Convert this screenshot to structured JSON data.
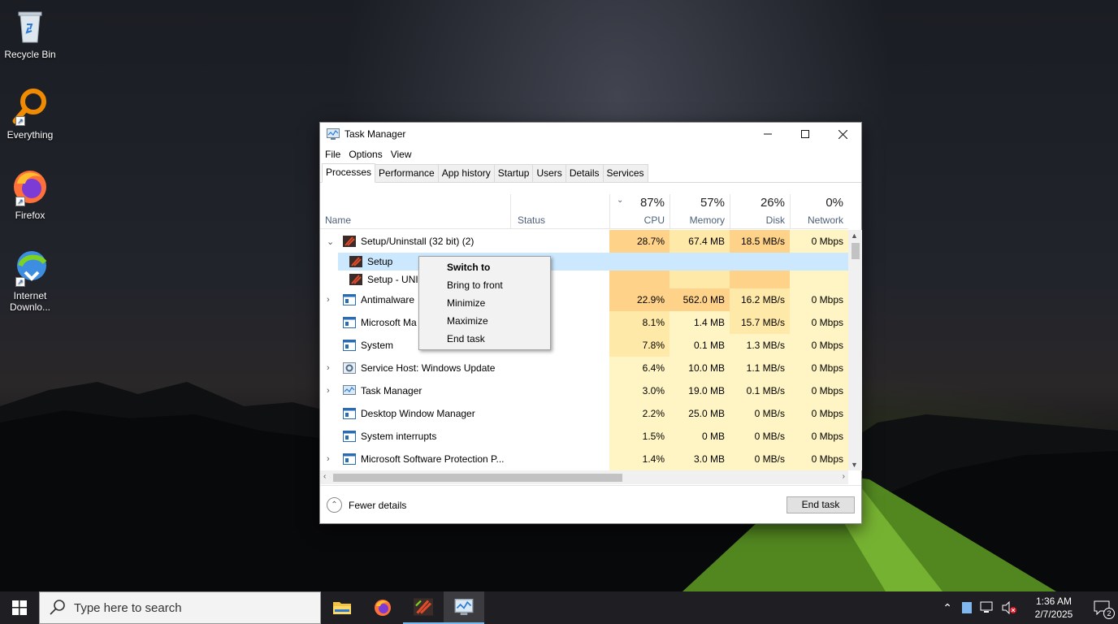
{
  "desktop": {
    "icons": [
      {
        "label": "Recycle Bin"
      },
      {
        "label": "Everything"
      },
      {
        "label": "Firefox"
      },
      {
        "label": "Internet Downlo..."
      }
    ]
  },
  "task_manager": {
    "title": "Task Manager",
    "menu": [
      "File",
      "Options",
      "View"
    ],
    "tabs": [
      "Processes",
      "Performance",
      "App history",
      "Startup",
      "Users",
      "Details",
      "Services"
    ],
    "active_tab": "Processes",
    "columns": {
      "name": "Name",
      "status": "Status",
      "cpu": {
        "pct": "87%",
        "label": "CPU"
      },
      "memory": {
        "pct": "57%",
        "label": "Memory"
      },
      "disk": {
        "pct": "26%",
        "label": "Disk"
      },
      "network": {
        "pct": "0%",
        "label": "Network"
      }
    },
    "processes": [
      {
        "name": "Setup/Uninstall (32 bit) (2)",
        "cpu": "28.7%",
        "memory": "67.4 MB",
        "disk": "18.5 MB/s",
        "network": "0 Mbps"
      },
      {
        "name": "Antimalware",
        "cpu": "22.9%",
        "memory": "562.0 MB",
        "disk": "16.2 MB/s",
        "network": "0 Mbps"
      },
      {
        "name": "Microsoft Ma",
        "cpu": "8.1%",
        "memory": "1.4 MB",
        "disk": "15.7 MB/s",
        "network": "0 Mbps"
      },
      {
        "name": "System",
        "cpu": "7.8%",
        "memory": "0.1 MB",
        "disk": "1.3 MB/s",
        "network": "0 Mbps"
      },
      {
        "name": "Service Host: Windows Update",
        "cpu": "6.4%",
        "memory": "10.0 MB",
        "disk": "1.1 MB/s",
        "network": "0 Mbps"
      },
      {
        "name": "Task Manager",
        "cpu": "3.0%",
        "memory": "19.0 MB",
        "disk": "0.1 MB/s",
        "network": "0 Mbps"
      },
      {
        "name": "Desktop Window Manager",
        "cpu": "2.2%",
        "memory": "25.0 MB",
        "disk": "0 MB/s",
        "network": "0 Mbps"
      },
      {
        "name": "System interrupts",
        "cpu": "1.5%",
        "memory": "0 MB",
        "disk": "0 MB/s",
        "network": "0 Mbps"
      },
      {
        "name": "Microsoft Software Protection P...",
        "cpu": "1.4%",
        "memory": "3.0 MB",
        "disk": "0 MB/s",
        "network": "0 Mbps"
      }
    ],
    "sub_items": [
      "Setup",
      "Setup - UNI"
    ],
    "footer": {
      "fewer_details": "Fewer details",
      "end_task": "End task"
    }
  },
  "context_menu": {
    "items": [
      "Switch to",
      "Bring to front",
      "Minimize",
      "Maximize",
      "End task"
    ]
  },
  "taskbar": {
    "search_placeholder": "Type here to search",
    "time": "1:36 AM",
    "date": "2/7/2025",
    "notification_count": "2"
  },
  "colors": {
    "heat_high": "#ffd28a",
    "heat_mid": "#ffe9a8",
    "heat_low": "#fff4c4",
    "selection": "#cce8ff",
    "taskbar": "#1f1f23"
  }
}
